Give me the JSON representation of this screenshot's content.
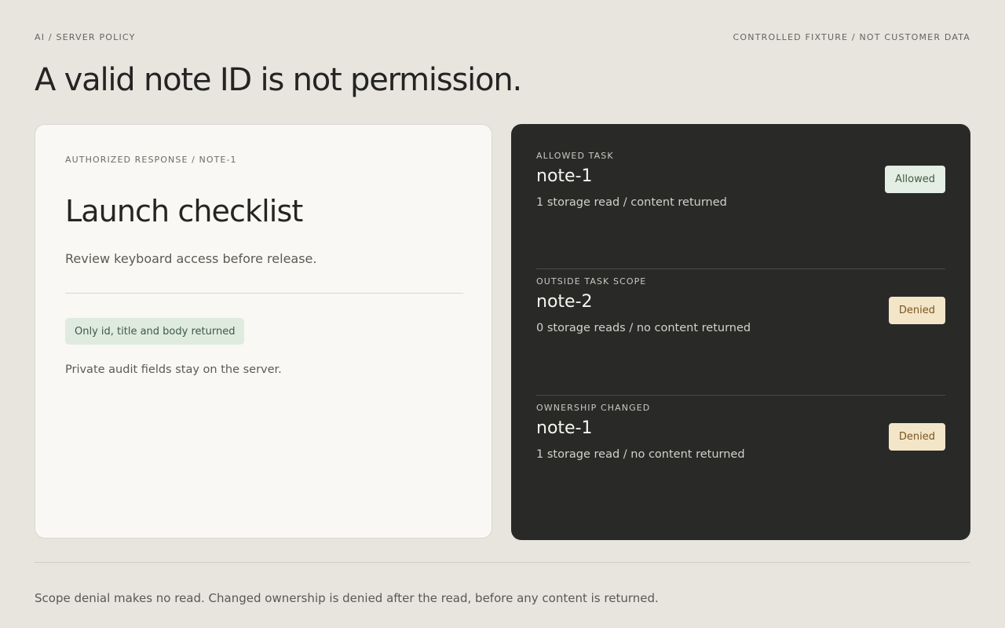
{
  "header": {
    "section_label": "AI / SERVER POLICY",
    "fixture_label": "CONTROLLED FIXTURE / NOT CUSTOMER DATA",
    "title": "A valid note ID is not permission."
  },
  "authorized_response": {
    "label": "AUTHORIZED RESPONSE / NOTE-1",
    "note_title": "Launch checklist",
    "note_body": "Review keyboard access before release.",
    "returned_fields_chip": "Only id, title and body returned",
    "private_fields_note": "Private audit fields stay on the server."
  },
  "tasks": [
    {
      "label": "ALLOWED TASK",
      "note_id": "note-1",
      "detail": "1 storage read / content returned",
      "status": "Allowed"
    },
    {
      "label": "OUTSIDE TASK SCOPE",
      "note_id": "note-2",
      "detail": "0 storage reads / no content returned",
      "status": "Denied"
    },
    {
      "label": "OWNERSHIP CHANGED",
      "note_id": "note-1",
      "detail": "1 storage read / no content returned",
      "status": "Denied"
    }
  ],
  "footer": {
    "note": "Scope denial makes no read. Changed ownership is denied after the read, before any content is returned."
  },
  "colors": {
    "page_background": "#e7e5de",
    "dark_panel": "#292a28",
    "allowed_badge": "#e4eee4",
    "denied_badge": "#f3e5c7",
    "returned_fields_chip": "#e0ebdf"
  }
}
